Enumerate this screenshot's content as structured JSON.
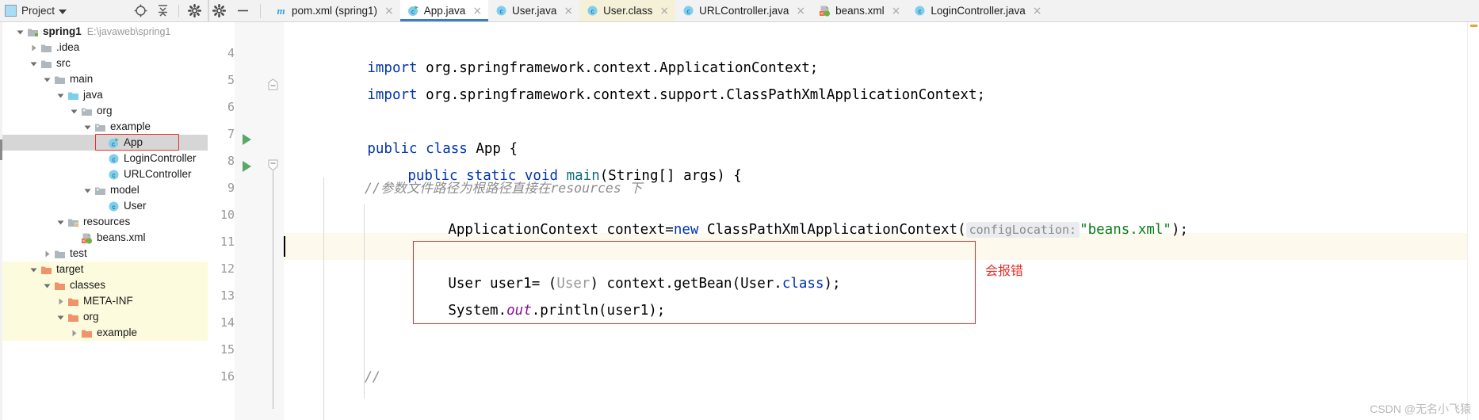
{
  "project_toolbar": {
    "label": "Project",
    "icons": [
      "project-square-icon",
      "chevron-down-icon",
      "locate-target-icon",
      "collapse-all-icon",
      "settings-gear-icon",
      "hide-minimize-icon"
    ]
  },
  "editor_toolbar": {
    "gear_icon": "settings-gear-icon",
    "minimize_icon": "minimize-icon"
  },
  "tabs": [
    {
      "label": "pom.xml (spring1)",
      "icon": "maven-m-icon",
      "state": "normal",
      "close": "×"
    },
    {
      "label": "App.java",
      "icon": "java-class-run-icon",
      "state": "active",
      "close": "×"
    },
    {
      "label": "User.java",
      "icon": "java-class-icon",
      "state": "normal",
      "close": "×"
    },
    {
      "label": "User.class",
      "icon": "java-class-icon",
      "state": "yellow",
      "close": "×"
    },
    {
      "label": "URLController.java",
      "icon": "java-class-icon",
      "state": "normal",
      "close": "×"
    },
    {
      "label": "beans.xml",
      "icon": "spring-xml-icon",
      "state": "normal",
      "close": "×"
    },
    {
      "label": "LoginController.java",
      "icon": "java-class-icon",
      "state": "normal",
      "close": "×"
    }
  ],
  "tree": [
    {
      "label": "spring1",
      "path": "E:\\javaweb\\spring1",
      "indent": 0,
      "twisty": "down",
      "icon": "module-folder-icon",
      "bold": true,
      "state": "normal"
    },
    {
      "label": ".idea",
      "path": "",
      "indent": 1,
      "twisty": "right",
      "icon": "folder-icon",
      "bold": false,
      "state": "normal"
    },
    {
      "label": "src",
      "path": "",
      "indent": 1,
      "twisty": "down",
      "icon": "folder-icon",
      "bold": false,
      "state": "normal"
    },
    {
      "label": "main",
      "path": "",
      "indent": 2,
      "twisty": "down",
      "icon": "folder-icon",
      "bold": false,
      "state": "normal"
    },
    {
      "label": "java",
      "path": "",
      "indent": 3,
      "twisty": "down",
      "icon": "source-folder-icon",
      "bold": false,
      "state": "normal"
    },
    {
      "label": "org",
      "path": "",
      "indent": 4,
      "twisty": "down",
      "icon": "package-icon",
      "bold": false,
      "state": "normal"
    },
    {
      "label": "example",
      "path": "",
      "indent": 5,
      "twisty": "down",
      "icon": "package-icon",
      "bold": false,
      "state": "normal"
    },
    {
      "label": "App",
      "path": "",
      "indent": 6,
      "twisty": "none",
      "icon": "java-class-run-icon",
      "bold": false,
      "state": "selected"
    },
    {
      "label": "LoginController",
      "path": "",
      "indent": 6,
      "twisty": "none",
      "icon": "java-class-icon",
      "bold": false,
      "state": "normal"
    },
    {
      "label": "URLController",
      "path": "",
      "indent": 6,
      "twisty": "none",
      "icon": "java-class-icon",
      "bold": false,
      "state": "normal"
    },
    {
      "label": "model",
      "path": "",
      "indent": 5,
      "twisty": "down",
      "icon": "package-icon",
      "bold": false,
      "state": "normal"
    },
    {
      "label": "User",
      "path": "",
      "indent": 6,
      "twisty": "none",
      "icon": "java-class-icon",
      "bold": false,
      "state": "normal"
    },
    {
      "label": "resources",
      "path": "",
      "indent": 3,
      "twisty": "down",
      "icon": "resource-folder-icon",
      "bold": false,
      "state": "normal"
    },
    {
      "label": "beans.xml",
      "path": "",
      "indent": 4,
      "twisty": "none",
      "icon": "spring-xml-icon",
      "bold": false,
      "state": "normal"
    },
    {
      "label": "test",
      "path": "",
      "indent": 2,
      "twisty": "right",
      "icon": "folder-icon",
      "bold": false,
      "state": "normal"
    },
    {
      "label": "target",
      "path": "",
      "indent": 1,
      "twisty": "down",
      "icon": "orange-folder-icon",
      "bold": false,
      "state": "yellow"
    },
    {
      "label": "classes",
      "path": "",
      "indent": 2,
      "twisty": "down",
      "icon": "orange-folder-icon",
      "bold": false,
      "state": "yellow"
    },
    {
      "label": "META-INF",
      "path": "",
      "indent": 3,
      "twisty": "right",
      "icon": "orange-folder-icon",
      "bold": false,
      "state": "yellow"
    },
    {
      "label": "org",
      "path": "",
      "indent": 3,
      "twisty": "down",
      "icon": "orange-folder-icon",
      "bold": false,
      "state": "yellow"
    },
    {
      "label": "example",
      "path": "",
      "indent": 4,
      "twisty": "right",
      "icon": "orange-folder-icon",
      "bold": false,
      "state": "yellow"
    }
  ],
  "editor": {
    "line_numbers": [
      "4",
      "5",
      "6",
      "7",
      "8",
      "9",
      "10",
      "11",
      "12",
      "13",
      "14",
      "15",
      "16"
    ],
    "lines": {
      "l4_import": "import",
      "l4_pkg": " org.springframework.context.ApplicationContext;",
      "l5_import": "import",
      "l5_pkg": " org.springframework.context.support.ClassPathXmlApplicationContext;",
      "l7_public": "public",
      "l7_class": "class",
      "l7_name": " App {",
      "l8_public": "public",
      "l8_static": "static",
      "l8_void": "void",
      "l8_main": "main",
      "l8_args": "(String[] args) {",
      "l9_comment": "//参数文件路径为根路径直接在resources 下",
      "l10_a": "ApplicationContext context=",
      "l10_new": "new",
      "l10_b": " ClassPathXmlApplicationContext(",
      "l10_hint": "configLocation:",
      "l10_str": "\"beans.xml\"",
      "l10_end": ");",
      "l12_a": "User user1= (",
      "l12_cast": "User",
      "l12_b": ") context.getBean(User.",
      "l12_class": "class",
      "l12_end": ");",
      "l13_a": "System.",
      "l13_out": "out",
      "l13_b": ".println(user1);",
      "l16_comment": "//"
    },
    "annotation_text": "会报错"
  },
  "watermark": "CSDN @无名小飞猿",
  "colors": {
    "accent": "#3d7cc9",
    "annotation_red": "#e8302a",
    "run_green": "#59a869",
    "keyword_blue": "#0033b3",
    "string_green": "#067d17",
    "comment_grey": "#8c8c8c",
    "selection_grey": "#d6d6d6",
    "target_yellow": "#fcfbdd",
    "caret_line": "#fdf9ec"
  }
}
